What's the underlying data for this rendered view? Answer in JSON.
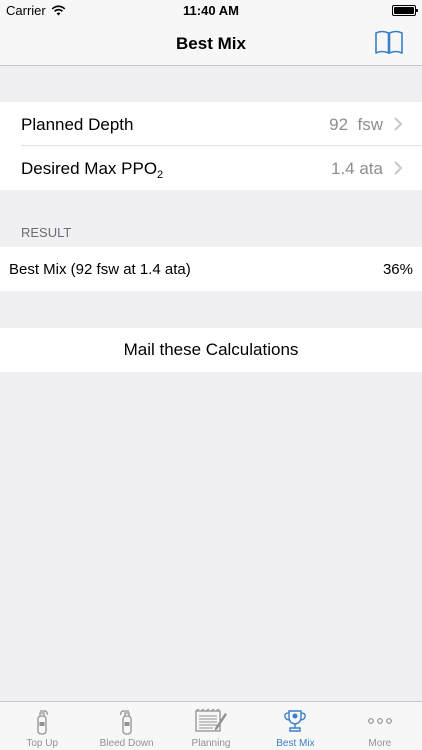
{
  "status_bar": {
    "carrier": "Carrier",
    "time": "11:40 AM"
  },
  "nav": {
    "title": "Best Mix",
    "right_icon": "book-icon"
  },
  "inputs": [
    {
      "label_main": "Desired Max PPO",
      "label_sub": "2",
      "value": "1.4 ata"
    }
  ],
  "planned_depth": {
    "label": "Planned Depth",
    "value": "92  fsw"
  },
  "result": {
    "header": "RESULT",
    "label": "Best Mix (92 fsw at 1.4 ata)",
    "value": "36%"
  },
  "mail_button": "Mail these Calculations",
  "tabs": [
    {
      "label": "Top Up",
      "icon": "tank-icon"
    },
    {
      "label": "Bleed Down",
      "icon": "tank-bleed-icon"
    },
    {
      "label": "Planning",
      "icon": "notepad-icon"
    },
    {
      "label": "Best Mix",
      "icon": "trophy-icon",
      "active": true
    },
    {
      "label": "More",
      "icon": "more-icon"
    }
  ],
  "colors": {
    "accent": "#3a7fc8",
    "background": "#efeff4",
    "secondary_text": "#8e8e93"
  }
}
